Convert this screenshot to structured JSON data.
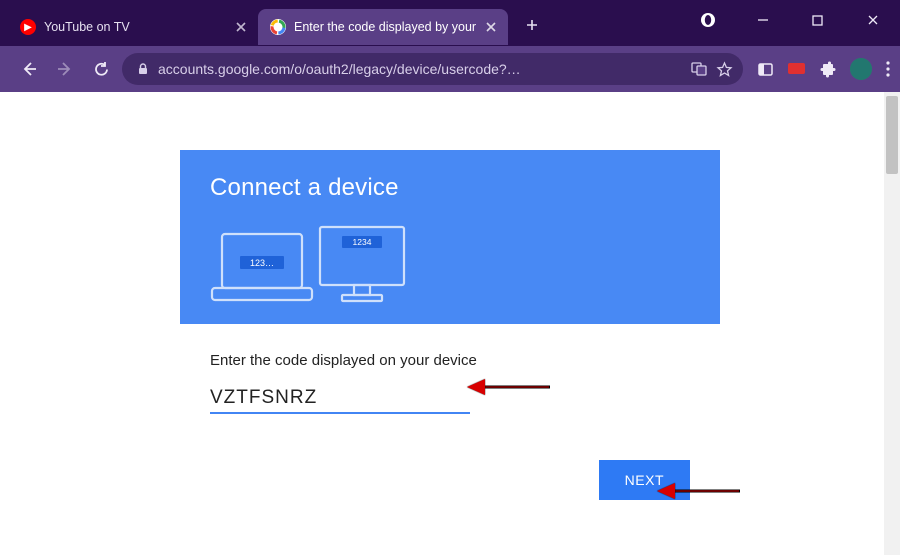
{
  "browser": {
    "tabs": [
      {
        "label": "YouTube on TV",
        "active": false,
        "favicon": "youtube"
      },
      {
        "label": "Enter the code displayed by your",
        "active": true,
        "favicon": "google"
      }
    ],
    "url": "accounts.google.com/o/oauth2/legacy/device/usercode?…"
  },
  "page": {
    "heading": "Connect a device",
    "prompt": "Enter the code displayed on your device",
    "code_value": "VZTFSNRZ",
    "next_label": "NEXT",
    "illustration": {
      "laptop_code": "123…",
      "monitor_code": "1234"
    }
  },
  "colors": {
    "header_blue": "#4889f4",
    "action_blue": "#2e7af4",
    "chrome_dark": "#2a0e4e",
    "chrome_mid": "#5a3f86"
  }
}
